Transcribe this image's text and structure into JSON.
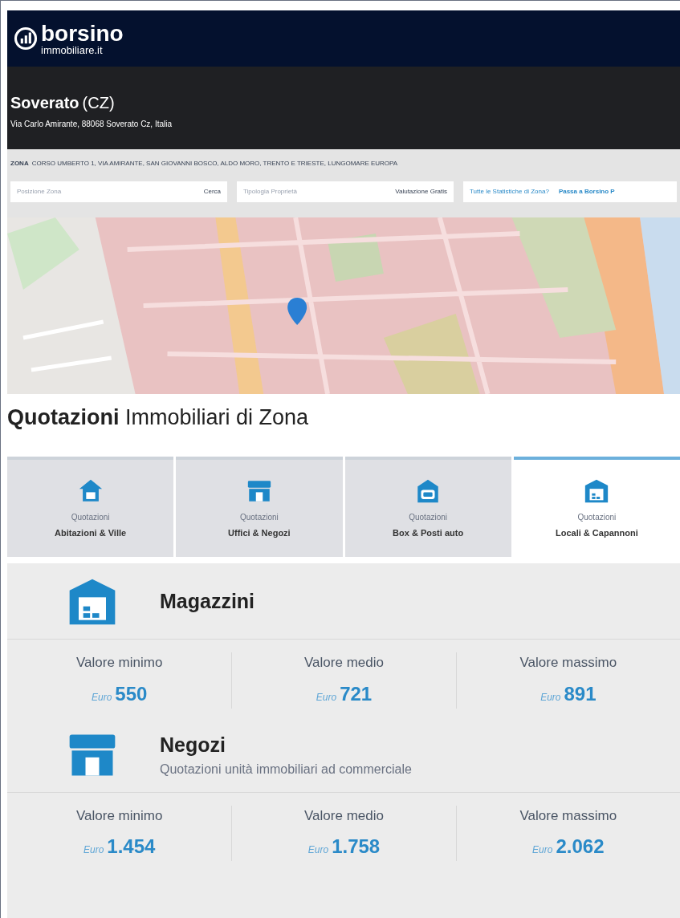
{
  "header": {
    "logo_name": "borsino",
    "logo_domain": "immobiliare.it"
  },
  "location": {
    "city": "Soverato",
    "province": "(CZ)",
    "address": "Via Carlo Amirante, 88068 Soverato Cz, Italia"
  },
  "zone": {
    "label": "ZONA",
    "streets": "CORSO UMBERTO 1, VIA AMIRANTE, SAN GIOVANNI BOSCO, ALDO MORO, TRENTO E TRIESTE, LUNGOMARE EUROPA"
  },
  "search": [
    {
      "placeholder": "Posizione Zona",
      "button": "Cerca"
    },
    {
      "placeholder": "Tipologia Proprietà",
      "button": "Valutazione Gratis"
    }
  ],
  "links": [
    "Tutte le Statistiche di Zona?",
    "Passa a Borsino P"
  ],
  "map": {
    "kind": "picture"
  },
  "heading": {
    "bold": "Quotazioni",
    "rest": "Immobiliari di Zona"
  },
  "tabs": [
    {
      "kind": "house",
      "caption": "Quotazioni",
      "label": "Abitazioni & Ville",
      "selected": false
    },
    {
      "kind": "shop",
      "caption": "Quotazioni",
      "label": "Uffici & Negozi",
      "selected": false
    },
    {
      "kind": "garage",
      "caption": "Quotazioni",
      "label": "Box & Posti auto",
      "selected": false
    },
    {
      "kind": "warehouse",
      "caption": "Quotazioni",
      "label": "Locali & Capannoni",
      "selected": true
    }
  ],
  "sections": [
    {
      "kind": "warehouse",
      "title": "Magazzini",
      "values": [
        {
          "label": "Valore minimo",
          "currency": "Euro",
          "amount": "550"
        },
        {
          "label": "Valore medio",
          "currency": "Euro",
          "amount": "721"
        },
        {
          "label": "Valore massimo",
          "currency": "Euro",
          "amount": "891"
        }
      ]
    },
    {
      "kind": "shop",
      "title": "Negozi",
      "subtitle": "Quotazioni unità immobiliari ad commerciale",
      "values": [
        {
          "label": "Valore minimo",
          "currency": "Euro",
          "amount": "1.454"
        },
        {
          "label": "Valore medio",
          "currency": "Euro",
          "amount": "1.758"
        },
        {
          "label": "Valore massimo",
          "currency": "Euro",
          "amount": "2.062"
        }
      ]
    }
  ]
}
